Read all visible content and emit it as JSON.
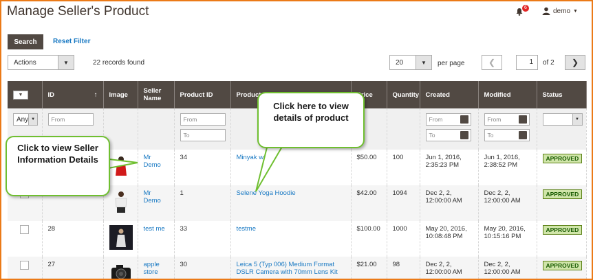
{
  "header": {
    "title": "Manage Seller's Product",
    "notification_count": "6",
    "user_name": "demo"
  },
  "toolbar": {
    "search_label": "Search",
    "reset_label": "Reset Filter",
    "actions_label": "Actions",
    "records_found": "22 records found",
    "per_page_value": "20",
    "per_page_label": "per page",
    "page_value": "1",
    "page_total": "of 2"
  },
  "columns": [
    "ID",
    "Image",
    "Seller Name",
    "Product ID",
    "Product",
    "Price",
    "Quantity",
    "Created",
    "Modified",
    "Status"
  ],
  "filters": {
    "any": "Any",
    "from": "From",
    "to": "To"
  },
  "rows": [
    {
      "id": "",
      "seller": "Mr Demo",
      "product_id": "34",
      "product": "Minyak wangi",
      "price": "$50.00",
      "qty": "100",
      "created": "Jun 1, 2016, 2:35:23 PM",
      "modified": "Jun 1, 2016, 2:38:52 PM",
      "status": "APPROVED"
    },
    {
      "id": "",
      "seller": "Mr Demo",
      "product_id": "1",
      "product": "Selene Yoga Hoodie",
      "price": "$42.00",
      "qty": "1094",
      "created": "Dec 2, 2, 12:00:00 AM",
      "modified": "Dec 2, 2, 12:00:00 AM",
      "status": "APPROVED"
    },
    {
      "id": "28",
      "seller": "test me",
      "product_id": "33",
      "product": "testme",
      "price": "$100.00",
      "qty": "1000",
      "created": "May 20, 2016, 10:08:48 PM",
      "modified": "May 20, 2016, 10:15:16 PM",
      "status": "APPROVED"
    },
    {
      "id": "27",
      "seller": "apple store",
      "product_id": "30",
      "product": "Leica 5 (Typ 006) Medium Format DSLR Camera with 70mm Lens Kit",
      "price": "$21.00",
      "qty": "98",
      "created": "Dec 2, 2, 12:00:00 AM",
      "modified": "Dec 2, 2, 12:00:00 AM",
      "status": "APPROVED"
    }
  ],
  "callouts": {
    "seller": "Click to view Seller Information Details",
    "product": "Click here to view details of product"
  },
  "colors": {
    "accent": "#eb7a17",
    "header_bg": "#514943",
    "link": "#1979c3",
    "callout_border": "#6fbf30"
  }
}
